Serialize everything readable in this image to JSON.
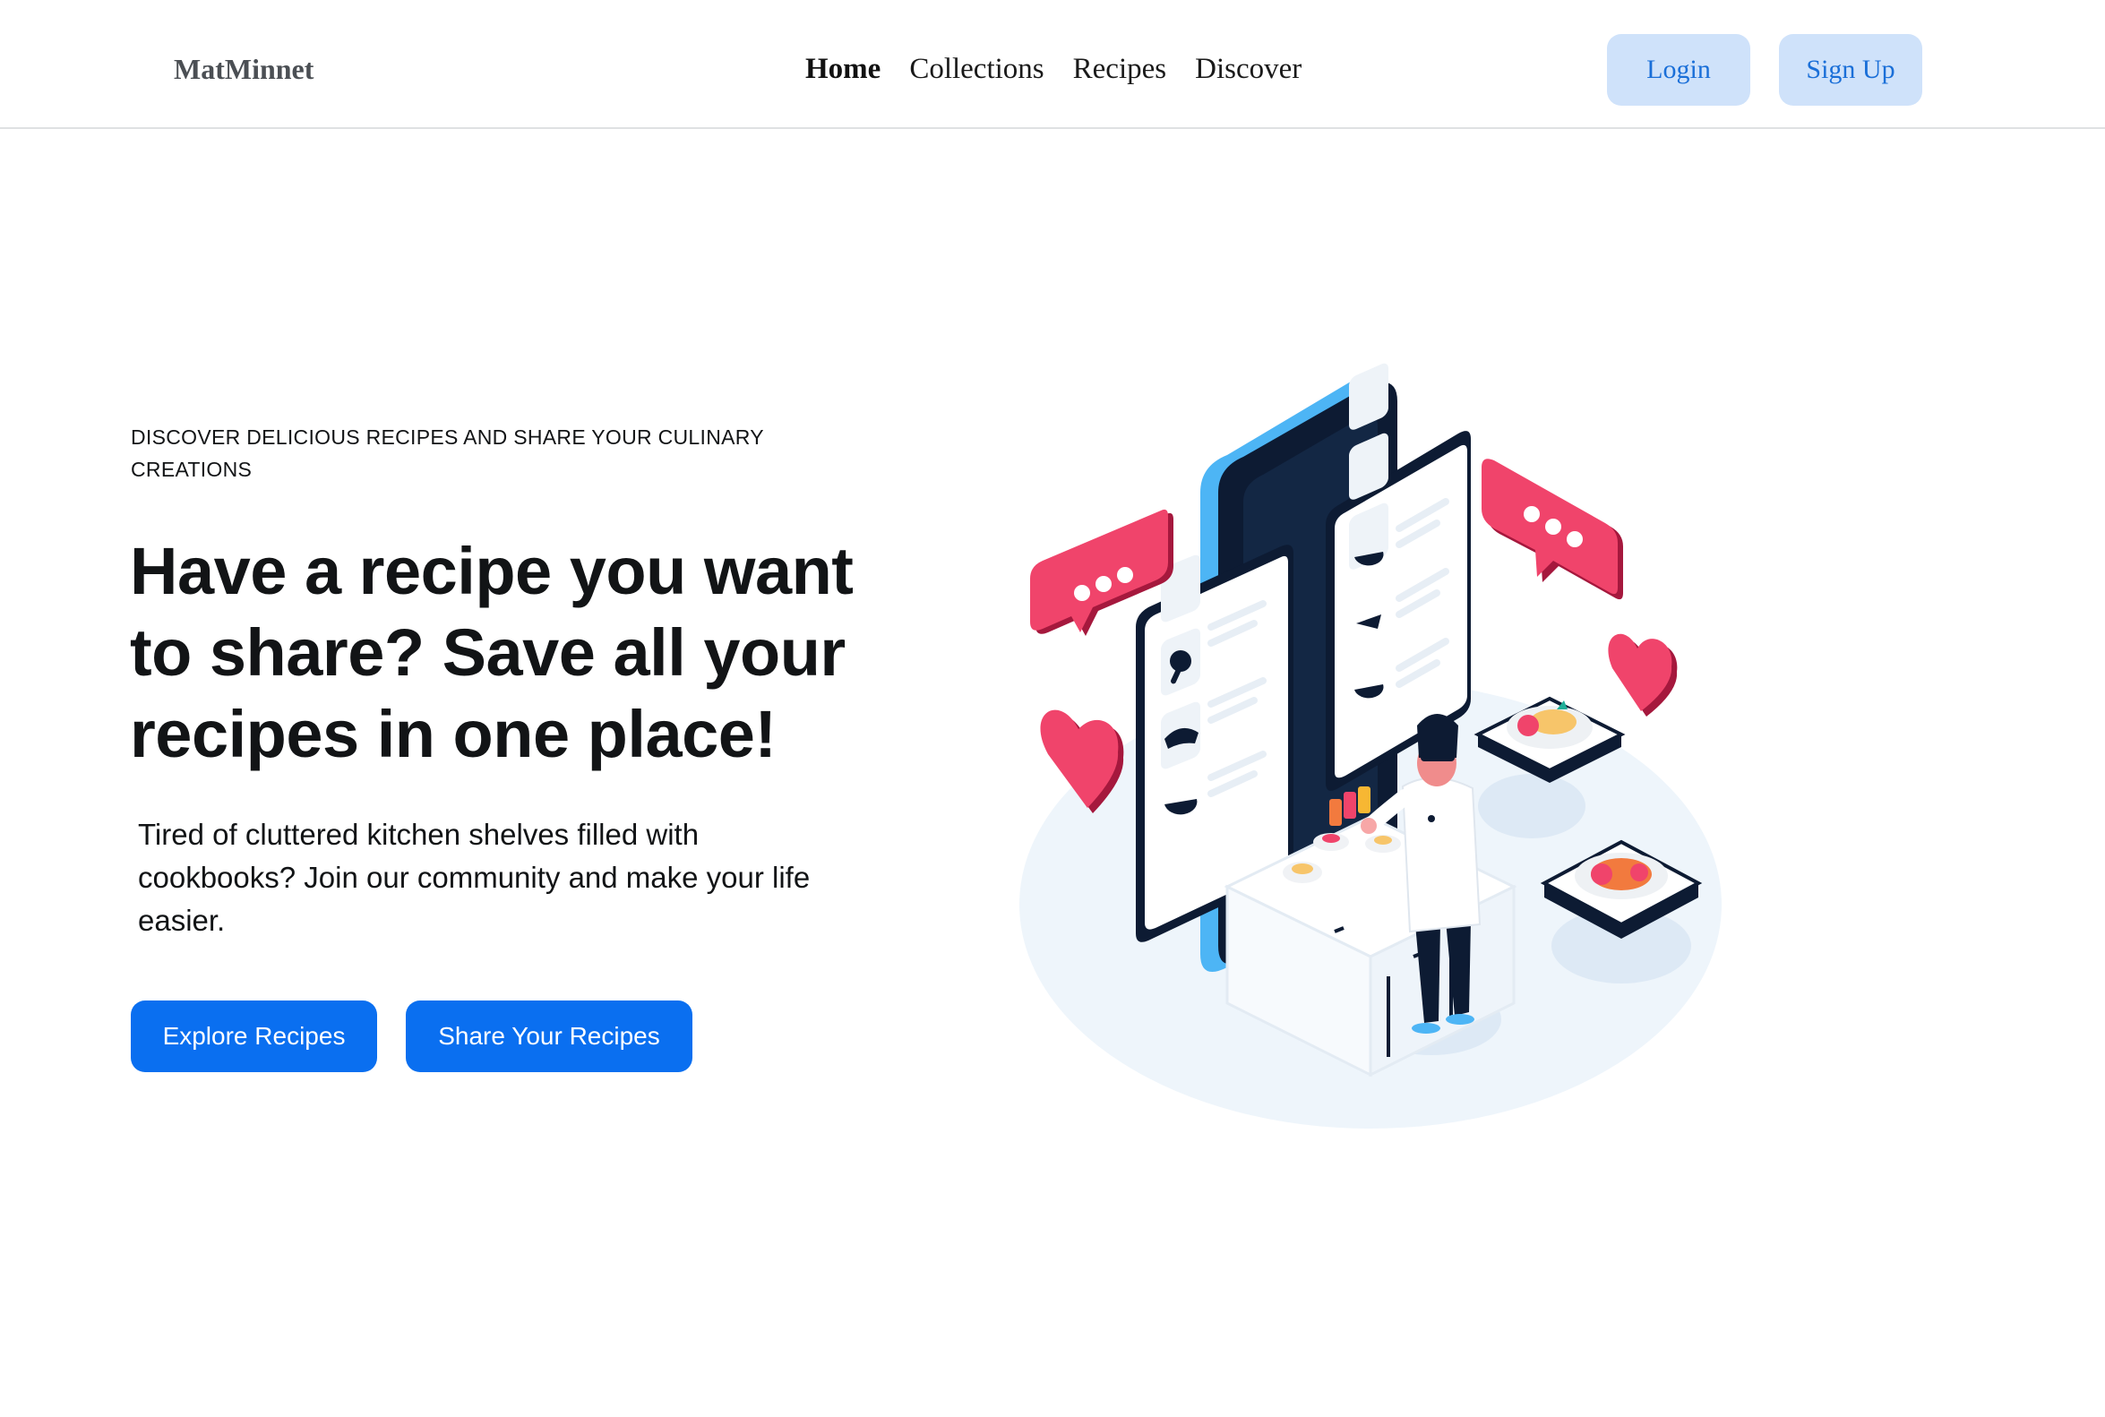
{
  "header": {
    "brand": "MatMinnet",
    "nav": {
      "home": "Home",
      "collections": "Collections",
      "recipes": "Recipes",
      "discover": "Discover"
    },
    "login_label": "Login",
    "signup_label": "Sign Up"
  },
  "hero": {
    "eyebrow": "DISCOVER DELICIOUS RECIPES AND SHARE YOUR CULINARY CREATIONS",
    "headline": "Have a recipe you want to share? Save all your recipes in one place!",
    "lead": "Tired of cluttered kitchen shelves filled with cookbooks? Join our community and make your life easier.",
    "explore_label": "Explore Recipes",
    "share_label": "Share Your Recipes"
  },
  "illustration": {
    "subject": "chef-with-recipe-app-isometric",
    "colors": {
      "accent_pink": "#f0446b",
      "phone_navy": "#0d1b33",
      "phone_edge_blue": "#4db5f5",
      "floor_tint": "#eef5fb"
    }
  },
  "colors": {
    "primary": "#0a6ff0",
    "header_button_bg": "#cfe2fa",
    "header_button_text": "#1a6fd8"
  }
}
